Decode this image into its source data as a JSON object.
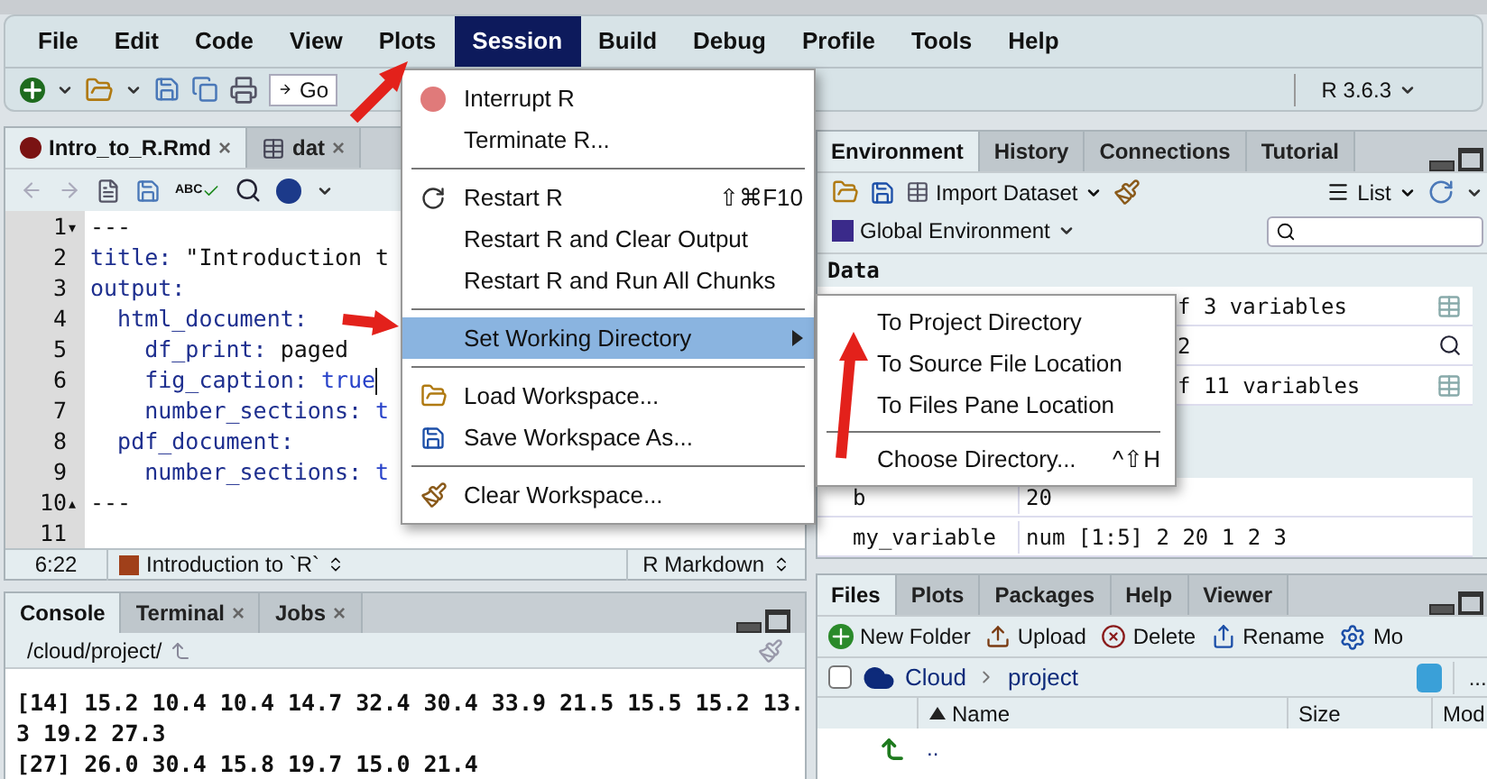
{
  "menubar": [
    {
      "label": "File",
      "selected": false
    },
    {
      "label": "Edit",
      "selected": false
    },
    {
      "label": "Code",
      "selected": false
    },
    {
      "label": "View",
      "selected": false
    },
    {
      "label": "Plots",
      "selected": false
    },
    {
      "label": "Session",
      "selected": true
    },
    {
      "label": "Build",
      "selected": false
    },
    {
      "label": "Debug",
      "selected": false
    },
    {
      "label": "Profile",
      "selected": false
    },
    {
      "label": "Tools",
      "selected": false
    },
    {
      "label": "Help",
      "selected": false
    }
  ],
  "main_toolbar": {
    "goto_label": "Go",
    "r_version": "R 3.6.3"
  },
  "editor": {
    "tabs": [
      {
        "label": "Intro_to_R.Rmd",
        "selected": true,
        "kind": "rmd",
        "close_label": "×"
      },
      {
        "label": "dat",
        "selected": false,
        "kind": "data",
        "close_label": "×"
      }
    ],
    "spellcheck_label": "ABC",
    "lines": [
      {
        "number": "1",
        "fold_marker": "▾",
        "cursor": false,
        "tokens": [
          {
            "kind": "text",
            "text": "---"
          }
        ]
      },
      {
        "number": "2",
        "cursor": false,
        "tokens": [
          {
            "kind": "key",
            "text": "title:"
          },
          {
            "kind": "text",
            "text": " \"Introduction t"
          }
        ]
      },
      {
        "number": "3",
        "cursor": false,
        "tokens": [
          {
            "kind": "key",
            "text": "output:"
          }
        ]
      },
      {
        "number": "4",
        "cursor": false,
        "tokens": [
          {
            "kind": "key",
            "text": "  html_document:"
          }
        ]
      },
      {
        "number": "5",
        "cursor": false,
        "tokens": [
          {
            "kind": "key",
            "text": "    df_print:"
          },
          {
            "kind": "text",
            "text": " paged"
          }
        ]
      },
      {
        "number": "6",
        "cursor": true,
        "tokens": [
          {
            "kind": "key",
            "text": "    fig_caption:"
          },
          {
            "kind": "literal",
            "text": " true"
          }
        ]
      },
      {
        "number": "7",
        "cursor": false,
        "tokens": [
          {
            "kind": "key",
            "text": "    number_sections:"
          },
          {
            "kind": "literal",
            "text": " t"
          }
        ]
      },
      {
        "number": "8",
        "cursor": false,
        "tokens": [
          {
            "kind": "key",
            "text": "  pdf_document:"
          }
        ]
      },
      {
        "number": "9",
        "cursor": false,
        "tokens": [
          {
            "kind": "key",
            "text": "    number_sections:"
          },
          {
            "kind": "literal",
            "text": " t"
          }
        ]
      },
      {
        "number": "10",
        "fold_marker": "▴",
        "cursor": false,
        "tokens": [
          {
            "kind": "text",
            "text": "---"
          }
        ]
      },
      {
        "number": "11",
        "cursor": false
      }
    ],
    "status": {
      "position": "6:22",
      "section": "Introduction to `R`",
      "mode": "R Markdown"
    }
  },
  "console": {
    "tabs": [
      {
        "label": "Console",
        "selected": true
      },
      {
        "label": "Terminal",
        "selected": false,
        "close_label": "×"
      },
      {
        "label": "Jobs",
        "selected": false,
        "close_label": "×"
      }
    ],
    "path": "/cloud/project/",
    "output": [
      "[14] 15.2 10.4 10.4 14.7 32.4 30.4 33.9 21.5 15.5 15.2 13.",
      "3 19.2 27.3",
      "[27] 26.0 30.4 15.8 19.7 15.0 21.4"
    ]
  },
  "environment": {
    "tabs": [
      {
        "label": "Environment",
        "selected": true
      },
      {
        "label": "History",
        "selected": false
      },
      {
        "label": "Connections",
        "selected": false
      },
      {
        "label": "Tutorial",
        "selected": false
      }
    ],
    "import_label": "Import Dataset",
    "view_label": "List",
    "scope": "Global Environment",
    "section": "Data",
    "data_rows": [
      {
        "value": "f 3 variables",
        "kind": "table"
      },
      {
        "value": "2",
        "kind": "object"
      },
      {
        "value": "f 11 variables",
        "kind": "table"
      }
    ],
    "value_rows": [
      {
        "name": "b",
        "value": "20"
      },
      {
        "name": "my_variable",
        "value": "num [1:5] 2 20 1 2 3"
      }
    ]
  },
  "files": {
    "tabs": [
      {
        "label": "Files",
        "selected": true
      },
      {
        "label": "Plots",
        "selected": false
      },
      {
        "label": "Packages",
        "selected": false
      },
      {
        "label": "Help",
        "selected": false
      },
      {
        "label": "Viewer",
        "selected": false
      }
    ],
    "toolbar": [
      "New Folder",
      "Upload",
      "Delete",
      "Rename",
      "Mo"
    ],
    "breadcrumb": [
      "Cloud",
      "project"
    ],
    "select_all": {
      "checked": false
    },
    "more_label": "...",
    "columns": [
      "Name",
      "Size",
      "Mod"
    ],
    "rows": [
      {
        "name": ".."
      }
    ]
  },
  "session_menu": [
    {
      "kind": "item",
      "label": "Interrupt R",
      "selected": false
    },
    {
      "kind": "item",
      "label": "Terminate R...",
      "selected": false
    },
    {
      "kind": "separator"
    },
    {
      "kind": "item",
      "label": "Restart R",
      "shortcut": "⇧⌘F10",
      "selected": false
    },
    {
      "kind": "item",
      "label": "Restart R and Clear Output",
      "selected": false
    },
    {
      "kind": "item",
      "label": "Restart R and Run All Chunks",
      "selected": false
    },
    {
      "kind": "separator"
    },
    {
      "kind": "submenu",
      "label": "Set Working Directory",
      "selected": true
    },
    {
      "kind": "separator"
    },
    {
      "kind": "item",
      "label": "Load Workspace...",
      "selected": false
    },
    {
      "kind": "item",
      "label": "Save Workspace As...",
      "selected": false
    },
    {
      "kind": "separator"
    },
    {
      "kind": "item",
      "label": "Clear Workspace...",
      "selected": false
    }
  ],
  "working_directory_menu": [
    {
      "kind": "item",
      "label": "To Project Directory",
      "selected": false
    },
    {
      "kind": "item",
      "label": "To Source File Location",
      "selected": false
    },
    {
      "kind": "item",
      "label": "To Files Pane Location",
      "selected": false
    },
    {
      "kind": "separator"
    },
    {
      "kind": "item",
      "label": "Choose Directory...",
      "shortcut": "^⇧H",
      "selected": false
    }
  ]
}
